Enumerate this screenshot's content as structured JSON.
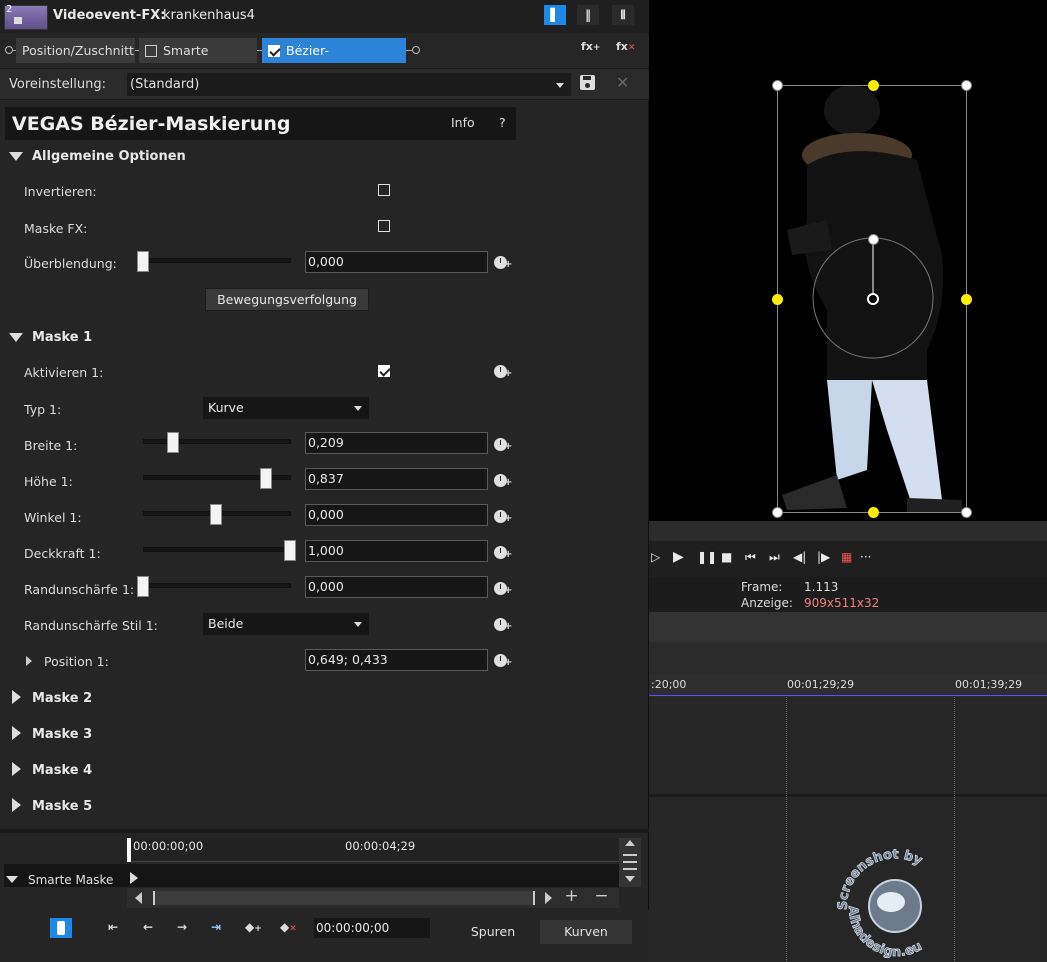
{
  "titlebar": {
    "track_number": "2",
    "title_label": "Videoevent-FX:",
    "event_name": "krankenhaus4"
  },
  "chain": {
    "items": [
      {
        "label": "Position/Zuschnitt",
        "checked": false,
        "has_checkbox": false
      },
      {
        "label": "Smarte Maske",
        "checked": false,
        "has_checkbox": true
      },
      {
        "label": "Bézier-Maskierung",
        "checked": true,
        "has_checkbox": true,
        "selected": true
      }
    ],
    "add_fx_icon": "fx-add-icon",
    "remove_fx_icon": "fx-remove-icon"
  },
  "preset": {
    "label": "Voreinstellung:",
    "value": "(Standard)"
  },
  "plugin": {
    "title": "VEGAS Bézier-Maskierung",
    "info_label": "Info",
    "help_label": "?"
  },
  "general": {
    "title": "Allgemeine Optionen",
    "invert_label": "Invertieren:",
    "maskfx_label": "Maske FX:",
    "blend_label": "Überblendung:",
    "blend_value": "0,000",
    "tracking_button": "Bewegungsverfolgung"
  },
  "mask1": {
    "title": "Maske 1",
    "activate_label": "Aktivieren 1:",
    "type_label": "Typ 1:",
    "type_value": "Kurve",
    "width_label": "Breite 1:",
    "width_value": "0,209",
    "height_label": "Höhe 1:",
    "height_value": "0,837",
    "angle_label": "Winkel 1:",
    "angle_value": "0,000",
    "opacity_label": "Deckkraft 1:",
    "opacity_value": "1,000",
    "feather_label": "Randunschärfe 1:",
    "feather_value": "0,000",
    "feather_style_label": "Randunschärfe Stil 1:",
    "feather_style_value": "Beide",
    "position_label": "Position 1:",
    "position_value": "0,649; 0,433"
  },
  "collapsed_sections": [
    "Maske 2",
    "Maske 3",
    "Maske 4",
    "Maske 5"
  ],
  "keyframes": {
    "time_start": "00:00:00;00",
    "time_mid": "00:00:04;29",
    "track_label": "Smarte Maske",
    "current_time": "00:00:00;00",
    "tab_tracks": "Spuren",
    "tab_curves": "Kurven"
  },
  "preview": {
    "frame_label": "Frame:",
    "frame_value": "1.113",
    "display_label": "Anzeige:",
    "display_value": "909x511x32"
  },
  "timeline": {
    "tick1": ":20;00",
    "tick2": "00:01;29;29",
    "tick3": "00:01;39;29"
  },
  "watermark": {
    "text_top": "Screenshot by",
    "text_bottom": "Alhadesign.eu"
  },
  "colors": {
    "accent": "#2c83d8",
    "handle_yellow": "#ffee00",
    "display_value": "#f08080"
  }
}
